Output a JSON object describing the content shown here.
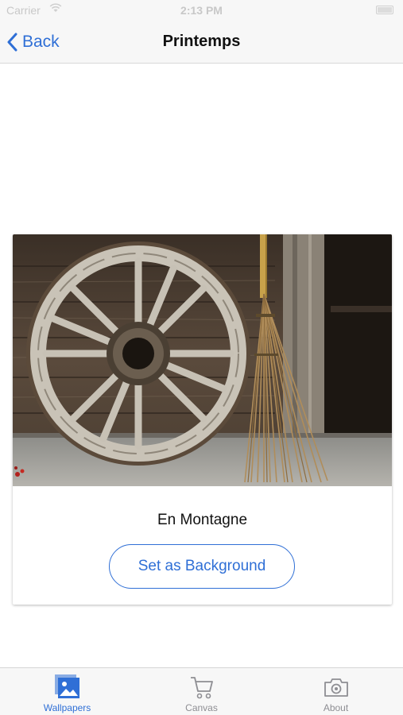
{
  "status_bar": {
    "carrier": "Carrier",
    "time": "2:13 PM"
  },
  "nav": {
    "back_label": "Back",
    "title": "Printemps"
  },
  "card": {
    "title": "En Montagne",
    "button_label": "Set as Background"
  },
  "tab_bar": {
    "tabs": [
      {
        "label": "Wallpapers",
        "icon": "photos-icon",
        "active": true
      },
      {
        "label": "Canvas",
        "icon": "cart-icon",
        "active": false
      },
      {
        "label": "About",
        "icon": "camera-icon",
        "active": false
      }
    ]
  },
  "colors": {
    "accent": "#2f6fd6",
    "inactive_tab": "#8e8e93",
    "bar_background": "#f7f7f7"
  }
}
